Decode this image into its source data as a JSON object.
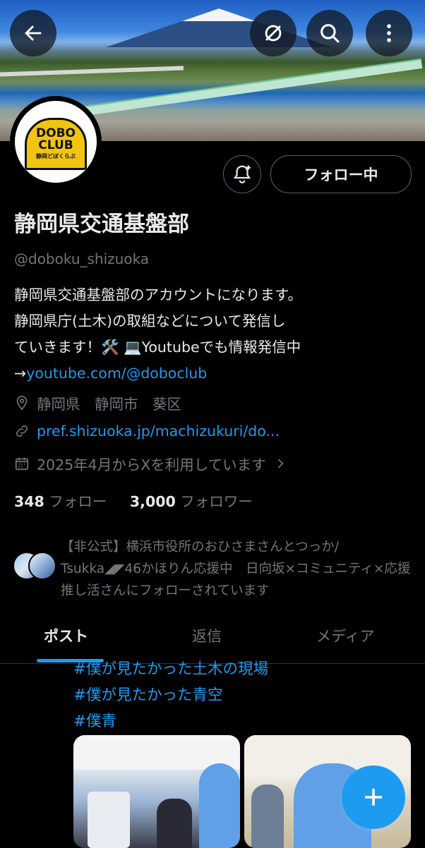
{
  "profile": {
    "name": "静岡県交通基盤部",
    "handle": "@doboku_shizuoka",
    "follow_button": "フォロー中",
    "logo_text_line1": "DOBO",
    "logo_text_line2": "CLUB",
    "logo_text_small": "静岡どぼくらぶ"
  },
  "bio": {
    "line1": "静岡県交通基盤部のアカウントになります。",
    "line2": "静岡県庁(土木)の取組などについて発信し",
    "line3a": "ていきます！🛠️",
    "line3b": "💻Youtubeでも情報発信中",
    "arrow": "→",
    "link": "youtube.com/@doboclub"
  },
  "meta": {
    "location": "静岡県　静岡市　葵区",
    "website": "pref.shizuoka.jp/machizukuri/do...",
    "joined": "2025年4月からXを利用しています"
  },
  "counts": {
    "following_num": "348",
    "following_label": "フォロー",
    "followers_num": "3,000",
    "followers_label": "フォロワー"
  },
  "followed_by": "【非公式】横浜市役所のおひさまさんとつっか/ Tsukka◢◤46かほりん応援中　日向坂×コミュニティ×応援推し活さんにフォローされています",
  "tabs": [
    "ポスト",
    "返信",
    "メディア"
  ],
  "post": {
    "hashtags": [
      "#僕が見たかった土木の現場",
      "#僕が見たかった青空",
      "#僕青"
    ]
  },
  "colors": {
    "accent": "#1d9bf0",
    "background": "#000000",
    "muted": "#71767b"
  },
  "icons": [
    "back-arrow-icon",
    "hide-icon",
    "search-icon",
    "more-icon",
    "bell-plus-icon",
    "location-icon",
    "link-icon",
    "calendar-icon",
    "chevron-right-icon",
    "plus-icon"
  ]
}
